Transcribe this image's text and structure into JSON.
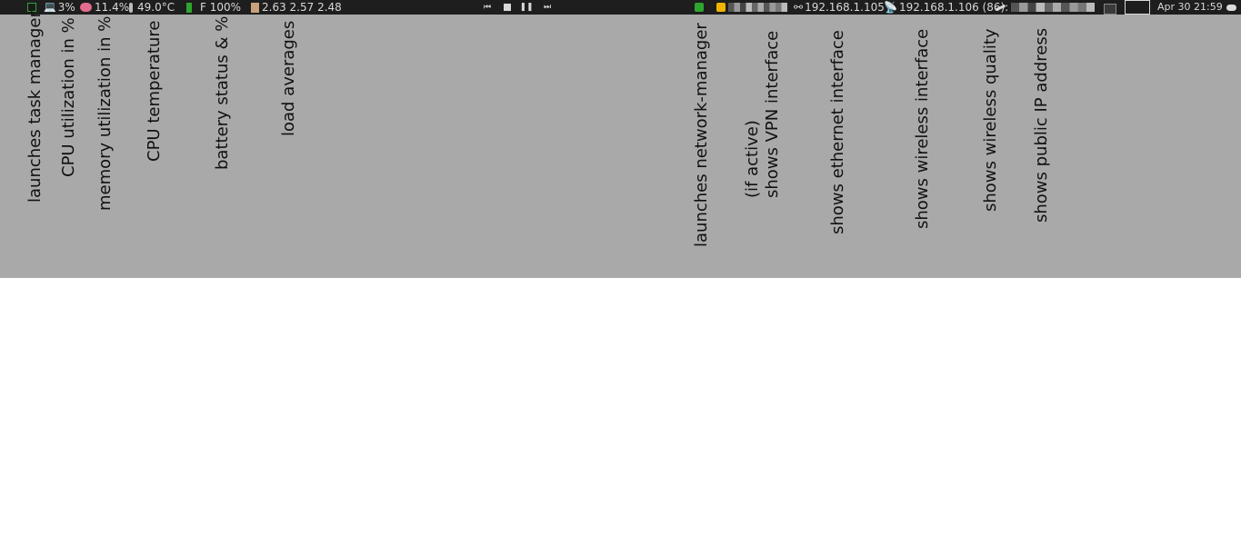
{
  "panel": {
    "cpu": "3%",
    "memory": "11.4%",
    "temperature": "49.0°C",
    "battery": "F 100%",
    "load": "2.63 2.57 2.48",
    "ethernet": "192.168.1.105",
    "wireless": "192.168.1.106 (86):",
    "clock": "Apr 30 21:59",
    "colors": {
      "background": "#1e1e1e",
      "text": "#d8d8d8",
      "green": "#2fa52f",
      "vpn": "#f0b400"
    },
    "icons": {
      "task_manager": "terminal-icon",
      "cpu": "laptop-icon",
      "memory": "brain-icon",
      "temperature": "thermometer-icon",
      "battery": "battery-icon",
      "load": "scroll-icon",
      "network_manager": "network-icon",
      "vpn": "lock-icon",
      "ethernet": "link-icon",
      "wireless": "satellite-icon",
      "quality": "signal-icon"
    }
  },
  "annotations": {
    "task_manager": "launches task manager",
    "cpu": "CPU utilization in %",
    "memory": "memory utilization in %",
    "temperature": "CPU temperature",
    "battery": "battery status & %",
    "load": "load averages",
    "network_manager": "launches network-manager",
    "vpn": "(if active)\nshows VPN interface",
    "ethernet": "shows ethernet interface",
    "wireless": "shows wireless interface",
    "quality": "shows wireless quality",
    "public_ip": "shows public IP address"
  },
  "annotation_area_color": "#a9a9a9"
}
